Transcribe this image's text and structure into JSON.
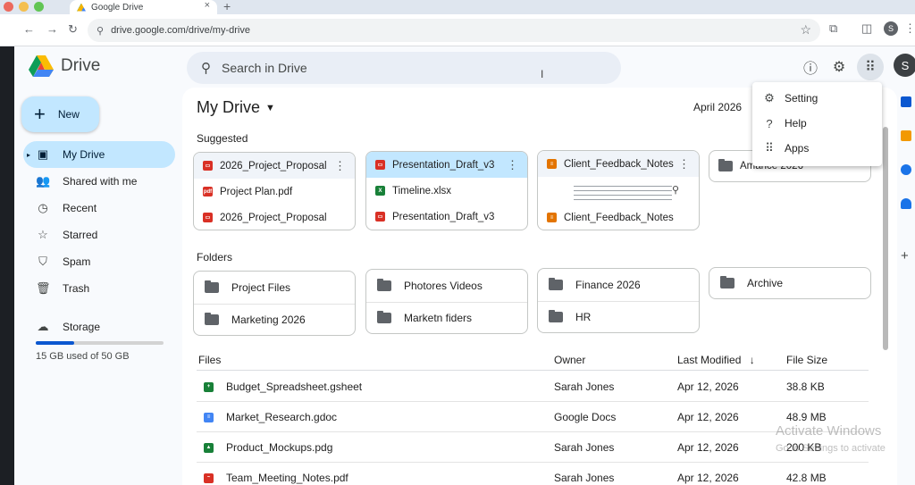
{
  "browser": {
    "tab_title": "Google Drive",
    "tab_close": "×",
    "new_tab": "+",
    "url": "drive.google.com/drive/my-drive",
    "profile_initial": "S",
    "traffic_colors": [
      "#ec6a5e",
      "#f4bf4f",
      "#61c554"
    ]
  },
  "header": {
    "app_name": "Drive",
    "search_placeholder": "Search in Drive",
    "avatar_initial": "S"
  },
  "menu": {
    "items": [
      {
        "label": "Setting",
        "icon": "gear-icon"
      },
      {
        "label": "Help",
        "icon": "help-icon"
      },
      {
        "label": "Apps",
        "icon": "apps-grid-icon"
      }
    ]
  },
  "sidebar": {
    "new_label": "New",
    "items": [
      {
        "label": "My Drive",
        "icon": "my-drive-icon",
        "active": true
      },
      {
        "label": "Shared with me",
        "icon": "people-icon"
      },
      {
        "label": "Recent",
        "icon": "clock-icon"
      },
      {
        "label": "Starred",
        "icon": "star-icon"
      },
      {
        "label": "Spam",
        "icon": "spam-icon"
      },
      {
        "label": "Trash",
        "icon": "trash-icon"
      }
    ],
    "storage_label": "Storage",
    "storage_text": "15 GB used of 50 GB",
    "storage_fraction": 0.3
  },
  "main": {
    "title": "My Drive",
    "date": "April 2026",
    "suggested_label": "Suggested",
    "folders_label": "Folders",
    "files_label": "Files",
    "suggested": [
      {
        "head": "2026_Project_Proposal",
        "rows": [
          "Project Plan.pdf",
          "2026_Project_Proposal"
        ]
      },
      {
        "head": "Presentation_Draft_v3",
        "rows": [
          "Timeline.xlsx",
          "Presentation_Draft_v3"
        ]
      },
      {
        "head": "Client_Feedback_Notes",
        "rows": [
          "Client_Feedback_Notes"
        ]
      },
      {
        "head": "Amance 2026",
        "rows": []
      }
    ],
    "folders": [
      [
        "Project Files",
        "Marketing 2026"
      ],
      [
        "Photores Videos",
        "Marketn fiders"
      ],
      [
        "Finance 2026",
        "HR"
      ],
      [
        "Archive"
      ]
    ],
    "table": {
      "headers": [
        "Owner",
        "Last Modified",
        "File Size"
      ],
      "sort_arrow": "↓",
      "rows": [
        {
          "name": "Budget_Spreadsheet.gsheet",
          "owner": "Sarah Jones",
          "modified": "Apr 12, 2026",
          "size": "38.8 KB",
          "color": "#188038"
        },
        {
          "name": "Market_Research.gdoc",
          "owner": "Google Docs",
          "modified": "Apr 12, 2026",
          "size": "48.9 MB",
          "color": "#4285f4"
        },
        {
          "name": "Product_Mockups.pdg",
          "owner": "Sarah Jones",
          "modified": "Apr 12, 2026",
          "size": "200 KB",
          "color": "#188038"
        },
        {
          "name": "Team_Meeting_Notes.pdf",
          "owner": "Sarah Jones",
          "modified": "Apr 12, 2026",
          "size": "42.8 MB",
          "color": "#d93025"
        }
      ]
    }
  },
  "watermark": {
    "line1": "Activate Windows",
    "line2": "Go to Settings to activate"
  }
}
